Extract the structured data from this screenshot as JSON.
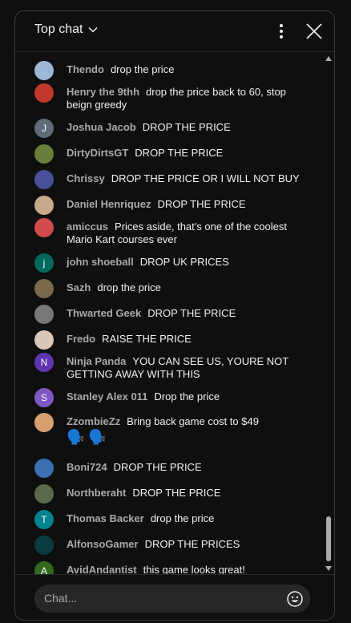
{
  "header": {
    "title": "Top chat",
    "dropdown_icon": "chevron-down-icon",
    "menu_icon": "more-vert-icon",
    "close_icon": "close-icon"
  },
  "messages": [
    {
      "author": "Thendo",
      "text": "drop the price",
      "avatar_initial": "",
      "avatar_color": "#9fb8d8"
    },
    {
      "author": "Henry the 9thh",
      "text": "drop the price back to 60, stop beign greedy",
      "avatar_initial": "",
      "avatar_color": "#c0392b"
    },
    {
      "author": "Joshua Jacob",
      "text": "DROP THE PRICE",
      "avatar_initial": "J",
      "avatar_color": "#5f6b7a"
    },
    {
      "author": "DirtyDirtsGT",
      "text": "DROP THE PRICE",
      "avatar_initial": "",
      "avatar_color": "#6b7d3a"
    },
    {
      "author": "Chrissy",
      "text": "DROP THE PRICE OR I WILL NOT BUY",
      "avatar_initial": "",
      "avatar_color": "#4a4f9a"
    },
    {
      "author": "Daniel Henriquez",
      "text": "DROP THE PRICE",
      "avatar_initial": "",
      "avatar_color": "#c8a98a"
    },
    {
      "author": "amiccus",
      "text": "Prices aside, that's one of the coolest Mario Kart courses ever",
      "avatar_initial": "",
      "avatar_color": "#d24a4a"
    },
    {
      "author": "john shoeball",
      "text": "DROP UK PRICES",
      "avatar_initial": "j",
      "avatar_color": "#00695c"
    },
    {
      "author": "Sazh",
      "text": "drop the price",
      "avatar_initial": "",
      "avatar_color": "#7a6a4a"
    },
    {
      "author": "Thwarted Geek",
      "text": "DROP THE PRICE",
      "avatar_initial": "",
      "avatar_color": "#777777"
    },
    {
      "author": "Fredo",
      "text": "RAISE THE PRICE",
      "avatar_initial": "",
      "avatar_color": "#d9c7b8"
    },
    {
      "author": "Ninja Panda",
      "text": "YOU CAN SEE US, YOURE NOT GETTING AWAY WITH THIS",
      "avatar_initial": "N",
      "avatar_color": "#5e35b1"
    },
    {
      "author": "Stanley Alex 011",
      "text": "Drop the price",
      "avatar_initial": "S",
      "avatar_color": "#7e57c2"
    },
    {
      "author": "ZzombieZz",
      "text": "Bring back game cost to $49",
      "emoji_line": "🗣️ 🗣️",
      "avatar_initial": "",
      "avatar_color": "#d8a070"
    },
    {
      "author": "Boni724",
      "text": "DROP THE PRICE",
      "avatar_initial": "",
      "avatar_color": "#3a6fb0"
    },
    {
      "author": "Northberaht",
      "text": "DROP THE PRICE",
      "avatar_initial": "",
      "avatar_color": "#5a6a4a"
    },
    {
      "author": "Thomas Backer",
      "text": "drop the price",
      "avatar_initial": "T",
      "avatar_color": "#00838f"
    },
    {
      "author": "AlfonsoGamer",
      "text": "DROP THE PRICES",
      "avatar_initial": "",
      "avatar_color": "#0b3a40"
    },
    {
      "author": "AvidAndantist",
      "text": "this game looks great!",
      "avatar_initial": "A",
      "avatar_color": "#33691e"
    }
  ],
  "chat_input": {
    "placeholder": "Chat...",
    "emoji_icon": "emoji-smile-icon"
  }
}
